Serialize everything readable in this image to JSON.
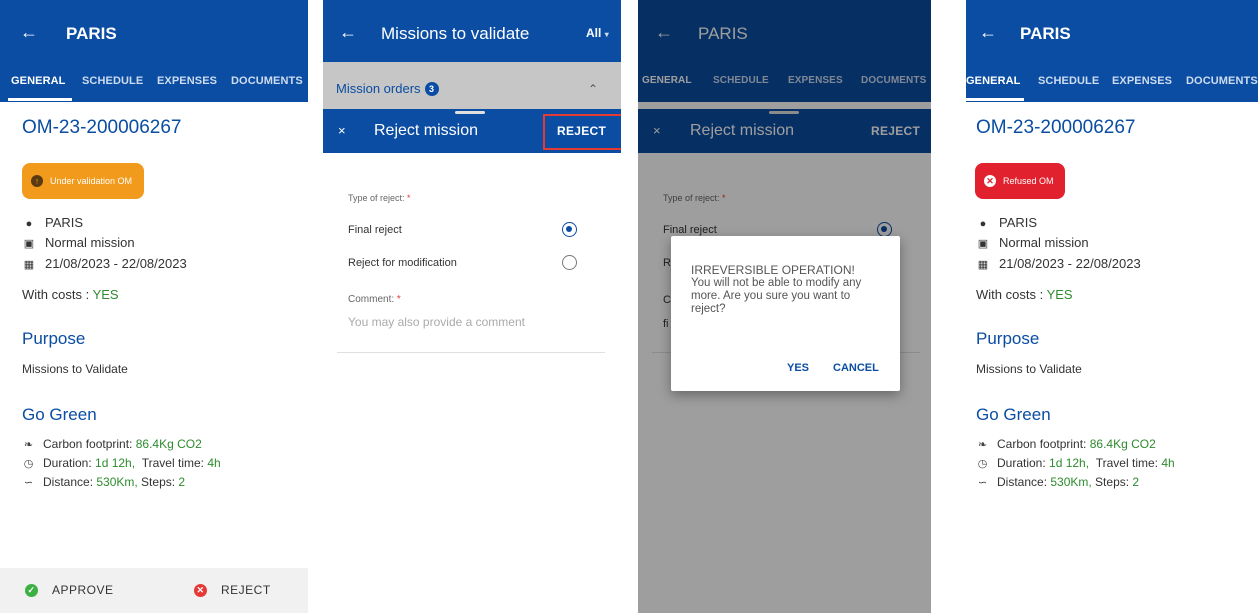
{
  "panel1": {
    "header": {
      "back_icon": "arrow-left-icon",
      "title": "PARIS"
    },
    "tabs": [
      "GENERAL",
      "SCHEDULE",
      "EXPENSES",
      "DOCUMENTS"
    ],
    "om_number": "OM-23-200006267",
    "status": {
      "label": "Under validation OM",
      "color": "#f29a1c",
      "icon": "arrow-up-circle-icon"
    },
    "destination": "PARIS",
    "mission_type": "Normal mission",
    "dates": "21/08/2023 - 22/08/2023",
    "costs_label": "With costs : ",
    "costs_value": "YES",
    "purpose_heading": "Purpose",
    "purpose_text": "Missions to Validate",
    "go_green_heading": "Go Green",
    "carbon_label": "Carbon footprint: ",
    "carbon_value": "86.4Kg CO2",
    "duration_label": "Duration: ",
    "duration_value": "1d 12h,",
    "travel_label": "Travel time: ",
    "travel_value": "4h",
    "distance_label": "Distance: ",
    "distance_value": "530Km,",
    "steps_label": " Steps: ",
    "steps_value": "2",
    "approve_label": "APPROVE",
    "reject_label": "REJECT",
    "approve_color": "#3cb043",
    "reject_color": "#e53935"
  },
  "panel2": {
    "header": {
      "title": "Missions to validate",
      "filter": "All"
    },
    "mission_orders_label": "Mission orders",
    "mission_orders_count": "3",
    "sheet": {
      "close": "×",
      "title": "Reject mission",
      "action": "REJECT"
    },
    "type_label": "Type of reject: ",
    "required_mark": "*",
    "option_final": "Final reject",
    "option_modify": "Reject for modification",
    "comment_label": "Comment: ",
    "comment_placeholder": "You may also provide a comment"
  },
  "panel3": {
    "header": {
      "title": "PARIS"
    },
    "tabs": [
      "GENERAL",
      "SCHEDULE",
      "EXPENSES",
      "DOCUMENTS"
    ],
    "sheet": {
      "close": "×",
      "title": "Reject mission",
      "action": "REJECT"
    },
    "type_label": "Type of reject: ",
    "option_final": "Final reject",
    "option_modify_partial": "R",
    "comment_partial": "C",
    "final_partial": "fi",
    "dialog": {
      "heading": "IRREVERSIBLE OPERATION!",
      "message": "You will not be able to modify any more. Are you sure you want to reject?",
      "yes": "YES",
      "cancel": "CANCEL"
    }
  },
  "panel4": {
    "header": {
      "title": "PARIS"
    },
    "tabs": [
      "GENERAL",
      "SCHEDULE",
      "EXPENSES",
      "DOCUMENTS"
    ],
    "om_number": "OM-23-200006267",
    "status": {
      "label": "Refused OM",
      "color": "#e2212e",
      "icon": "x-circle-icon"
    },
    "destination": "PARIS",
    "mission_type": "Normal mission",
    "dates": "21/08/2023 - 22/08/2023",
    "costs_label": "With costs : ",
    "costs_value": "YES",
    "purpose_heading": "Purpose",
    "purpose_text": "Missions to Validate",
    "go_green_heading": "Go Green",
    "carbon_label": "Carbon footprint: ",
    "carbon_value": "86.4Kg CO2",
    "duration_label": "Duration: ",
    "duration_value": "1d 12h,",
    "travel_label": "Travel time: ",
    "travel_value": "4h",
    "distance_label": "Distance: ",
    "distance_value": "530Km,",
    "steps_label": " Steps: ",
    "steps_value": "2"
  }
}
